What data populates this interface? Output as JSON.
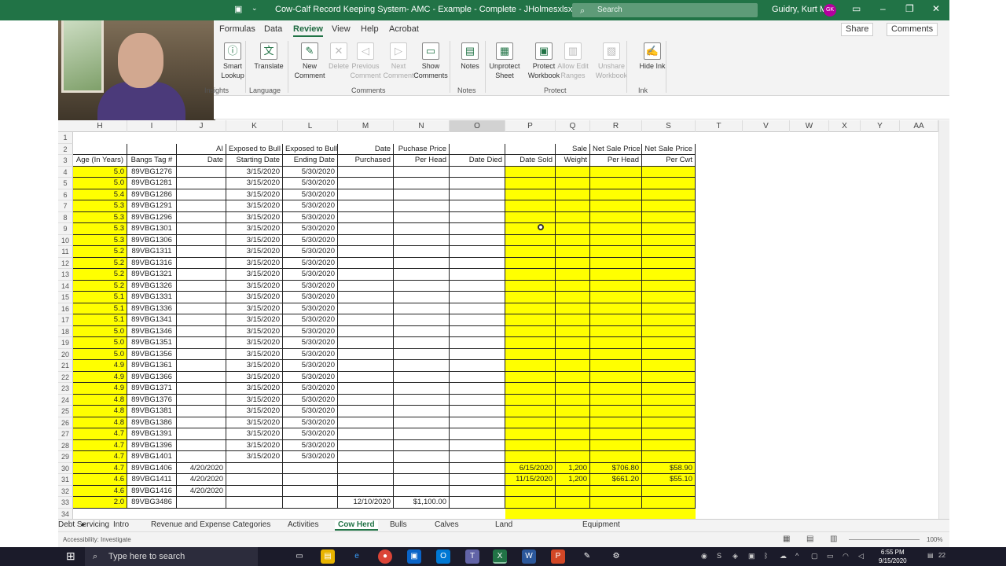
{
  "titlebar": {
    "title": "Cow-Calf Record Keeping System- AMC - Example - Complete - JHolmesxlsx...  •  Saved",
    "search_placeholder": "Search",
    "user": "Guidry, Kurt M.",
    "initials": "GK"
  },
  "tabs": [
    "Formulas",
    "Data",
    "Review",
    "View",
    "Help",
    "Acrobat"
  ],
  "active_tab": "Review",
  "share": {
    "share": "Share",
    "comments": "Comments"
  },
  "ribbon": {
    "buttons": [
      {
        "label": "Smart Lookup",
        "icon": "ⓘ",
        "enabled": true
      },
      {
        "label": "Translate",
        "icon": "文",
        "enabled": true
      },
      {
        "label": "New Comment",
        "icon": "✎",
        "enabled": true
      },
      {
        "label": "Delete",
        "icon": "✕",
        "enabled": false
      },
      {
        "label": "Previous Comment",
        "icon": "◁",
        "enabled": false
      },
      {
        "label": "Next Comment",
        "icon": "▷",
        "enabled": false
      },
      {
        "label": "Show Comments",
        "icon": "▭",
        "enabled": true
      },
      {
        "label": "Notes",
        "icon": "▤",
        "enabled": true
      },
      {
        "label": "Unprotect Sheet",
        "icon": "▦",
        "enabled": true
      },
      {
        "label": "Protect Workbook",
        "icon": "▣",
        "enabled": true
      },
      {
        "label": "Allow Edit Ranges",
        "icon": "▥",
        "enabled": false
      },
      {
        "label": "Unshare Workbook",
        "icon": "▧",
        "enabled": false
      },
      {
        "label": "Hide Ink",
        "icon": "✍",
        "enabled": true
      }
    ],
    "groups": [
      "Insights",
      "Language",
      "Comments",
      "Notes",
      "Protect",
      "Ink"
    ]
  },
  "columns": [
    "H",
    "I",
    "J",
    "K",
    "L",
    "M",
    "N",
    "O",
    "P",
    "Q",
    "R",
    "S",
    "T",
    "V",
    "W",
    "X",
    "Y",
    "AA"
  ],
  "header_row2": {
    "J": "AI",
    "K": "Exposed to Bull",
    "L": "Exposed to Bull",
    "M": "Date",
    "N": "Puchase Price",
    "Q": "Sale",
    "R": "Net Sale Price",
    "S": "Net Sale Price"
  },
  "header_row3": {
    "H": "Age (In Years)",
    "I": "Bangs Tag #",
    "J": "Date",
    "K": "Starting Date",
    "L": "Ending Date",
    "M": "Purchased",
    "N": "Per Head",
    "O": "Date Died",
    "P": "Date Sold",
    "Q": "Weight",
    "R": "Per Head",
    "S": "Per Cwt"
  },
  "rows": [
    {
      "n": "4",
      "H": "5.0",
      "I": "89VBG1276",
      "K": "3/15/2020",
      "L": "5/30/2020"
    },
    {
      "n": "5",
      "H": "5.0",
      "I": "89VBG1281",
      "K": "3/15/2020",
      "L": "5/30/2020"
    },
    {
      "n": "6",
      "H": "5.4",
      "I": "89VBG1286",
      "K": "3/15/2020",
      "L": "5/30/2020"
    },
    {
      "n": "7",
      "H": "5.3",
      "I": "89VBG1291",
      "K": "3/15/2020",
      "L": "5/30/2020"
    },
    {
      "n": "8",
      "H": "5.3",
      "I": "89VBG1296",
      "K": "3/15/2020",
      "L": "5/30/2020"
    },
    {
      "n": "9",
      "H": "5.3",
      "I": "89VBG1301",
      "K": "3/15/2020",
      "L": "5/30/2020"
    },
    {
      "n": "10",
      "H": "5.3",
      "I": "89VBG1306",
      "K": "3/15/2020",
      "L": "5/30/2020"
    },
    {
      "n": "11",
      "H": "5.2",
      "I": "89VBG1311",
      "K": "3/15/2020",
      "L": "5/30/2020"
    },
    {
      "n": "12",
      "H": "5.2",
      "I": "89VBG1316",
      "K": "3/15/2020",
      "L": "5/30/2020"
    },
    {
      "n": "13",
      "H": "5.2",
      "I": "89VBG1321",
      "K": "3/15/2020",
      "L": "5/30/2020"
    },
    {
      "n": "14",
      "H": "5.2",
      "I": "89VBG1326",
      "K": "3/15/2020",
      "L": "5/30/2020"
    },
    {
      "n": "15",
      "H": "5.1",
      "I": "89VBG1331",
      "K": "3/15/2020",
      "L": "5/30/2020"
    },
    {
      "n": "16",
      "H": "5.1",
      "I": "89VBG1336",
      "K": "3/15/2020",
      "L": "5/30/2020"
    },
    {
      "n": "17",
      "H": "5.1",
      "I": "89VBG1341",
      "K": "3/15/2020",
      "L": "5/30/2020"
    },
    {
      "n": "18",
      "H": "5.0",
      "I": "89VBG1346",
      "K": "3/15/2020",
      "L": "5/30/2020"
    },
    {
      "n": "19",
      "H": "5.0",
      "I": "89VBG1351",
      "K": "3/15/2020",
      "L": "5/30/2020"
    },
    {
      "n": "20",
      "H": "5.0",
      "I": "89VBG1356",
      "K": "3/15/2020",
      "L": "5/30/2020"
    },
    {
      "n": "21",
      "H": "4.9",
      "I": "89VBG1361",
      "K": "3/15/2020",
      "L": "5/30/2020"
    },
    {
      "n": "22",
      "H": "4.9",
      "I": "89VBG1366",
      "K": "3/15/2020",
      "L": "5/30/2020"
    },
    {
      "n": "23",
      "H": "4.9",
      "I": "89VBG1371",
      "K": "3/15/2020",
      "L": "5/30/2020"
    },
    {
      "n": "24",
      "H": "4.8",
      "I": "89VBG1376",
      "K": "3/15/2020",
      "L": "5/30/2020"
    },
    {
      "n": "25",
      "H": "4.8",
      "I": "89VBG1381",
      "K": "3/15/2020",
      "L": "5/30/2020"
    },
    {
      "n": "26",
      "H": "4.8",
      "I": "89VBG1386",
      "K": "3/15/2020",
      "L": "5/30/2020"
    },
    {
      "n": "27",
      "H": "4.7",
      "I": "89VBG1391",
      "K": "3/15/2020",
      "L": "5/30/2020"
    },
    {
      "n": "28",
      "H": "4.7",
      "I": "89VBG1396",
      "K": "3/15/2020",
      "L": "5/30/2020"
    },
    {
      "n": "29",
      "H": "4.7",
      "I": "89VBG1401",
      "K": "3/15/2020",
      "L": "5/30/2020"
    },
    {
      "n": "30",
      "H": "4.7",
      "I": "89VBG1406",
      "J": "4/20/2020",
      "P": "6/15/2020",
      "Q": "1,200",
      "R": "$706.80",
      "S": "$58.90"
    },
    {
      "n": "31",
      "H": "4.6",
      "I": "89VBG1411",
      "J": "4/20/2020",
      "P": "11/15/2020",
      "Q": "1,200",
      "R": "$661.20",
      "S": "$55.10"
    },
    {
      "n": "32",
      "H": "4.6",
      "I": "89VBG1416",
      "J": "4/20/2020"
    },
    {
      "n": "33",
      "H": "2.0",
      "I": "89VBG3486",
      "M": "12/10/2020",
      "N": "$1,100.00"
    },
    {
      "n": "34"
    }
  ],
  "sheet_tabs": [
    "Intro",
    "Revenue and Expense Categories",
    "Activities",
    "Cow Herd",
    "Bulls",
    "Calves",
    "Land",
    "Equipment",
    "Debt Servicing"
  ],
  "active_sheet": "Cow Herd",
  "status": {
    "accessibility": "Accessibility: Investigate",
    "zoom": "100%"
  },
  "taskbar": {
    "search": "Type here to search",
    "time": "6:55 PM",
    "date": "9/15/2020",
    "notif": "22"
  }
}
